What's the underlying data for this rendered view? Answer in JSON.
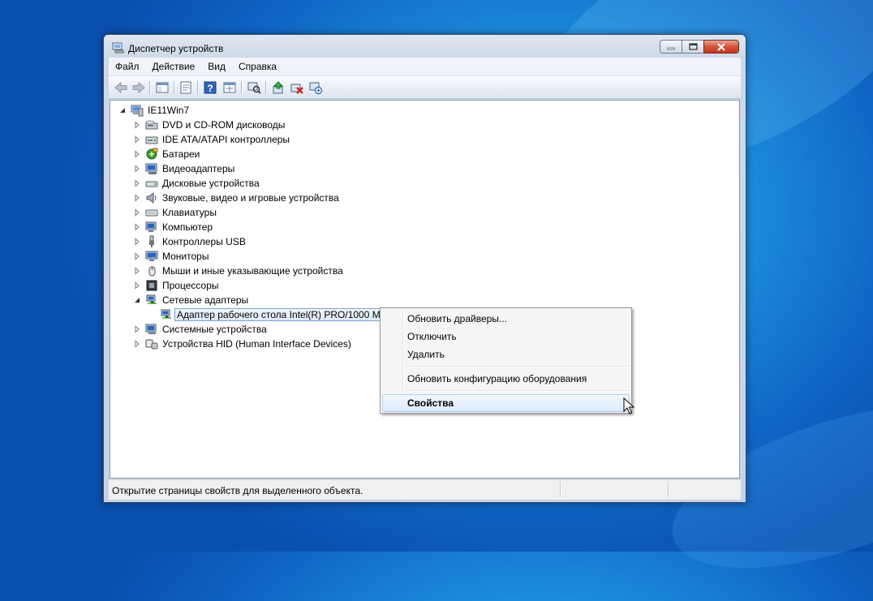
{
  "window": {
    "title": "Диспетчер устройств",
    "buttons": {
      "minimize": "minimize",
      "maximize": "maximize",
      "close": "close"
    }
  },
  "menu": [
    "Файл",
    "Действие",
    "Вид",
    "Справка"
  ],
  "toolbar": [
    "back-icon",
    "forward-icon",
    "show-hide-tree-icon",
    "properties-icon",
    "help-icon",
    "action-icon",
    "scan-hardware-icon",
    "update-driver-icon",
    "uninstall-icon",
    "disable-icon"
  ],
  "tree": {
    "root": "IE11Win7",
    "categories": [
      {
        "label": "DVD и CD-ROM дисководы",
        "icon": "dvd-icon"
      },
      {
        "label": "IDE ATA/ATAPI контроллеры",
        "icon": "ide-icon"
      },
      {
        "label": "Батареи",
        "icon": "battery-icon"
      },
      {
        "label": "Видеоадаптеры",
        "icon": "display-adapter-icon"
      },
      {
        "label": "Дисковые устройства",
        "icon": "disk-icon"
      },
      {
        "label": "Звуковые, видео и игровые устройства",
        "icon": "speaker-icon"
      },
      {
        "label": "Клавиатуры",
        "icon": "keyboard-icon"
      },
      {
        "label": "Компьютер",
        "icon": "computer-icon"
      },
      {
        "label": "Контроллеры USB",
        "icon": "usb-icon"
      },
      {
        "label": "Мониторы",
        "icon": "monitor-icon"
      },
      {
        "label": "Мыши и иные указывающие устройства",
        "icon": "mouse-icon"
      },
      {
        "label": "Процессоры",
        "icon": "cpu-icon"
      },
      {
        "label": "Сетевые адаптеры",
        "icon": "network-icon",
        "expanded": true
      },
      {
        "label": "Системные устройства",
        "icon": "system-icon"
      },
      {
        "label": "Устройства HID (Human Interface Devices)",
        "icon": "hid-icon"
      }
    ],
    "selected_child": "Адаптер рабочего стола Intel(R) PRO/1000 MT"
  },
  "context_menu": {
    "items": [
      "Обновить драйверы...",
      "Отключить",
      "Удалить",
      "Обновить конфигурацию оборудования",
      "Свойства"
    ],
    "highlighted": "Свойства"
  },
  "status": {
    "text": "Открытие страницы свойств для выделенного объекта."
  },
  "colors": {
    "accent": "#1d8fdd",
    "close": "#c3361f",
    "selection": "#dbe8f8"
  }
}
